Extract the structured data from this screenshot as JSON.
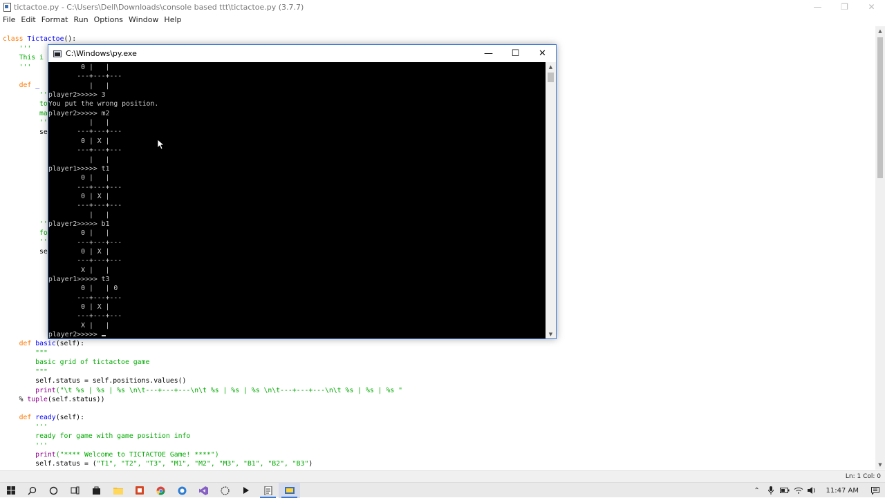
{
  "idle": {
    "title": "tictactoe.py - C:\\Users\\Dell\\Downloads\\console based ttt\\tictactoe.py (3.7.7)",
    "menu": [
      "File",
      "Edit",
      "Format",
      "Run",
      "Options",
      "Window",
      "Help"
    ],
    "status": "Ln: 1  Col: 0",
    "code_top": {
      "l1_kw": "class ",
      "l1_name": "Tictactoe",
      "l1_rest": "():",
      "l2": "    '''",
      "l3": "    This i",
      "l4": "    '''",
      "l5_kw": "    def ",
      "l5_rest": "_"
    },
    "code_left": {
      "a1": "''",
      "a2": "to",
      "a3": "ma",
      "a4": "''",
      "a5": "se",
      "b1": "''",
      "b2": "fo",
      "b3": "''",
      "b4": "se"
    },
    "code_bottom": {
      "basic_def_kw": "    def ",
      "basic_def_name": "basic",
      "basic_def_rest": "(self):",
      "q1": "        \"\"\"",
      "doc1": "        basic grid of tictactoe game",
      "q2": "        \"\"\"",
      "status_line": "        self.status = self.positions.values()",
      "print_bi": "        print",
      "print_str": "(\"\\t %s | %s | %s \\n\\t---+---+---\\n\\t %s | %s | %s \\n\\t---+---+---\\n\\t %s | %s | %s \"",
      "tuple_line_pre": "    % ",
      "tuple_bi": "tuple",
      "tuple_rest": "(self.status))",
      "ready_def_kw": "    def ",
      "ready_def_name": "ready",
      "ready_def_rest": "(self):",
      "rq1": "        '''",
      "rdoc": "        ready for game with game position info",
      "rq2": "        '''",
      "rprint_bi": "        print",
      "rprint_str": "(\"**** Welcome to TICTACTOE Game! ****\")",
      "rstatus_pre": "        self.status = (",
      "rstatus_str": "\"T1\", \"T2\", \"T3\", \"M1\", \"M2\", \"M3\", \"B1\", \"B2\", \"B3\"",
      "rstatus_post": ")"
    }
  },
  "console": {
    "title": "C:\\Windows\\py.exe",
    "lines": [
      "        0 |   |",
      "       ---+---+---",
      "          |   |",
      "player2>>>>> 3",
      "You put the wrong position.",
      "player2>>>>> m2",
      "          |   |",
      "       ---+---+---",
      "        0 | X |",
      "       ---+---+---",
      "          |   |",
      "player1>>>>> t1",
      "        0 |   |",
      "       ---+---+---",
      "        0 | X |",
      "       ---+---+---",
      "          |   |",
      "player2>>>>> b1",
      "        0 |   |",
      "       ---+---+---",
      "        0 | X |",
      "       ---+---+---",
      "        X |   |",
      "player1>>>>> t3",
      "        0 |   | 0",
      "       ---+---+---",
      "        0 | X |",
      "       ---+---+---",
      "        X |   |",
      "player2>>>>> "
    ]
  },
  "taskbar": {
    "clock": "11:47 AM",
    "apps": [
      "start-icon",
      "search-icon",
      "cortana-icon",
      "task-view-icon",
      "store-icon",
      "file-explorer-icon",
      "office-icon",
      "chrome-icon",
      "app-icon",
      "visual-studio-icon",
      "app-icon-2",
      "terminal-icon",
      "notepad-icon",
      "python-idle-icon"
    ]
  },
  "colors": {
    "keyword": "#ff7700",
    "definition": "#0000ff",
    "string": "#00aa00",
    "builtin": "#900090"
  }
}
